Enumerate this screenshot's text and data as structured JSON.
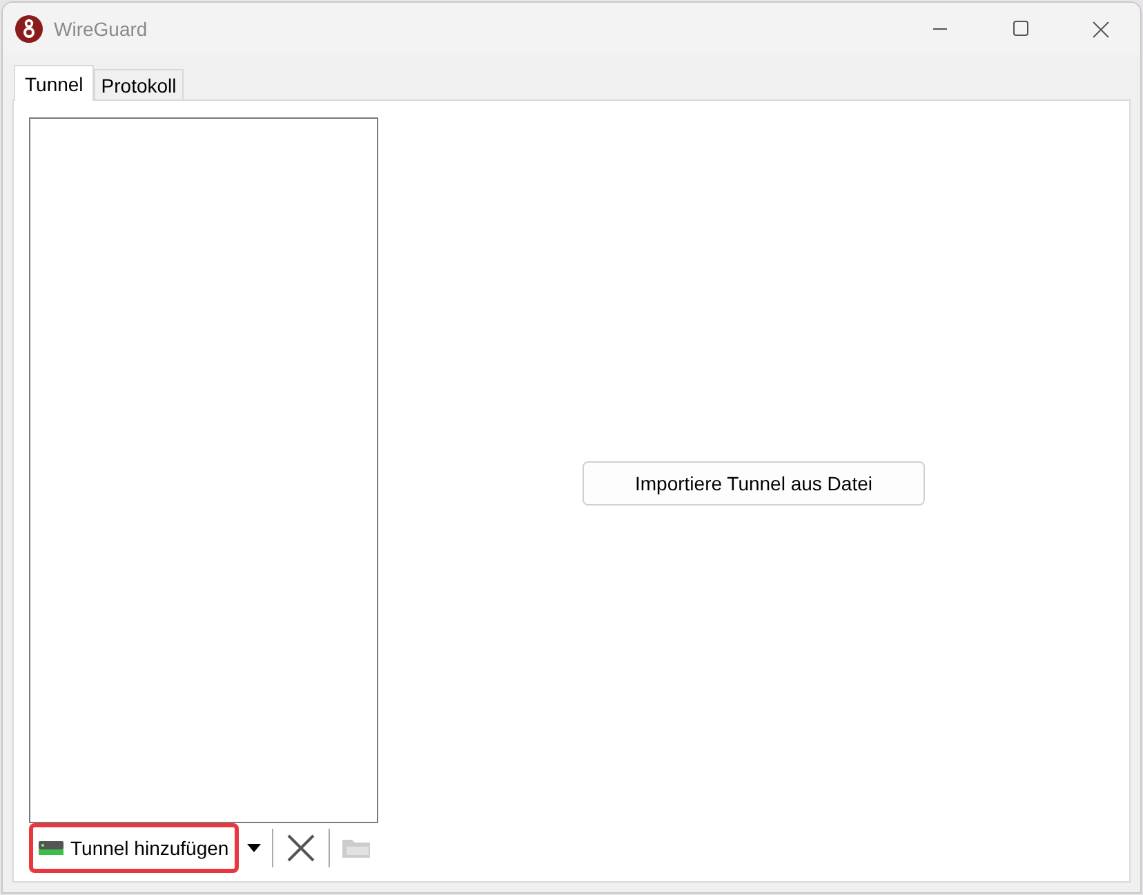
{
  "window": {
    "title": "WireGuard"
  },
  "tabs": [
    {
      "label": "Tunnel",
      "selected": true
    },
    {
      "label": "Protokoll",
      "selected": false
    }
  ],
  "toolbar": {
    "add_button": {
      "label": "Tunnel hinzufügen",
      "highlighted": true
    }
  },
  "import_button": {
    "label": "Importiere Tunnel aus Datei"
  }
}
